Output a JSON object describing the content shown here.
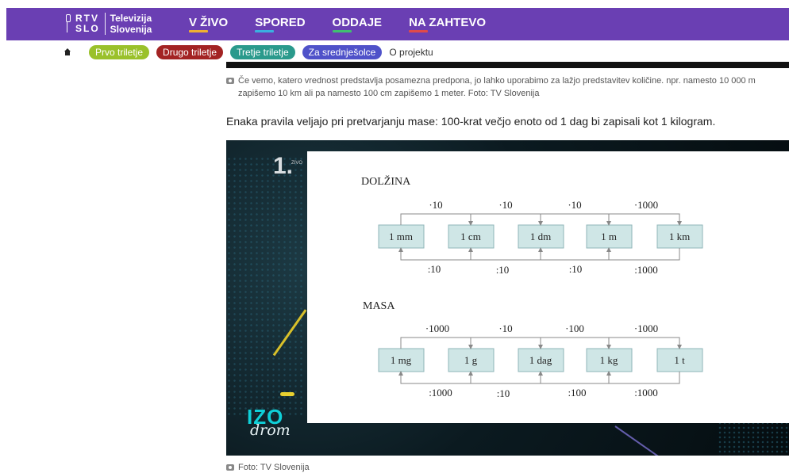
{
  "header": {
    "logo": {
      "line1": "RTV",
      "line2": "SLO",
      "tv_line1": "Televizija",
      "tv_line2": "Slovenija"
    },
    "nav": [
      {
        "label": "V ŽIVO",
        "underline": "#f0b030"
      },
      {
        "label": "SPORED",
        "underline": "#3ab0e0"
      },
      {
        "label": "ODDAJE",
        "underline": "#40c070"
      },
      {
        "label": "NA ZAHTEVO",
        "underline": "#e04a4a"
      }
    ],
    "bg_color": "#6a3fb3"
  },
  "subnav": {
    "home_icon": "home-icon",
    "pills": [
      {
        "label": "Prvo triletje",
        "color": "#9ac12b"
      },
      {
        "label": "Drugo triletje",
        "color": "#a32323"
      },
      {
        "label": "Tretje triletje",
        "color": "#2a9a8c"
      },
      {
        "label": "Za srednješolce",
        "color": "#4f52c9"
      }
    ],
    "plain": "O projektu"
  },
  "captions": {
    "first": "Če vemo, katero vrednost predstavlja posamezna predpona, jo lahko uporabimo za lažjo predstavitev količine. npr. namesto 10 000 m zapišemo 10 km ali pa namesto 100 cm zapišemo 1 meter. Foto: TV Slovenija",
    "second": "Foto: TV Slovenija"
  },
  "paragraph": "Enaka pravila veljajo pri pretvarjanju mase: 100-krat večjo enoto od 1 dag bi zapisali kot 1 kilogram.",
  "figure": {
    "number": "1.",
    "number_small": "ZIVO",
    "brand_top": "IZO",
    "brand_bottom": "drom",
    "dolzina": {
      "title": "DOLŽINA",
      "units": [
        "1 mm",
        "1 cm",
        "1 dm",
        "1 m",
        "1 km"
      ],
      "multiply": [
        "·10",
        "·10",
        "·10",
        "·1000"
      ],
      "divide": [
        ":10",
        ":10",
        ":10",
        ":1000"
      ]
    },
    "masa": {
      "title": "MASA",
      "units": [
        "1 mg",
        "1 g",
        "1 dag",
        "1 kg",
        "1 t"
      ],
      "multiply": [
        "·1000",
        "·10",
        "·100",
        "·1000"
      ],
      "divide": [
        ":1000",
        ":10",
        ":100",
        ":1000"
      ]
    }
  }
}
